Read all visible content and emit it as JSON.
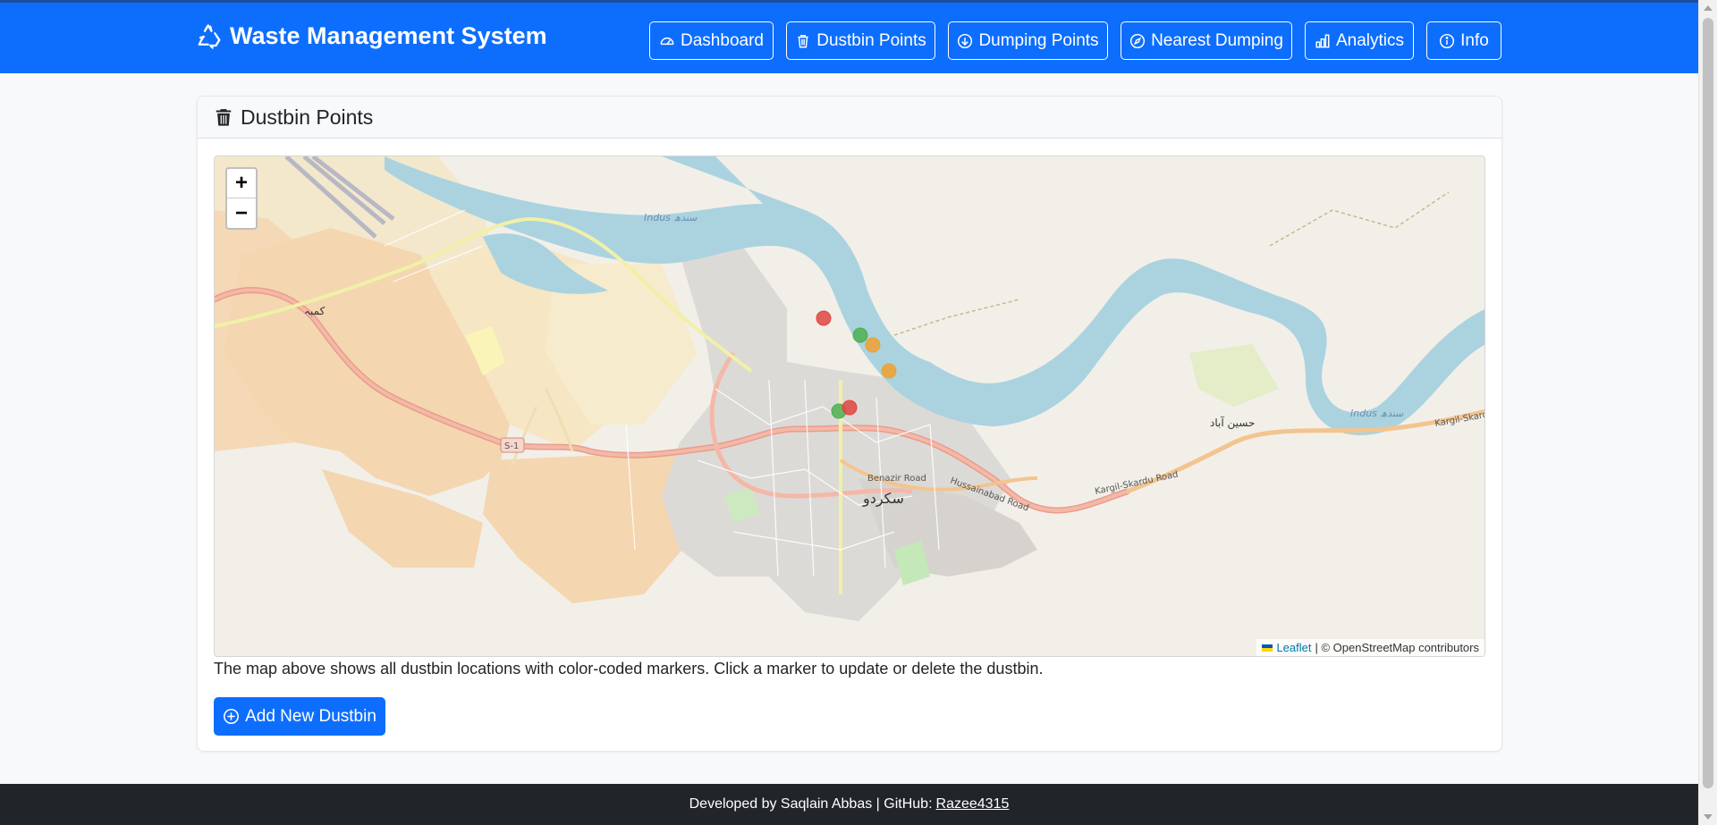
{
  "brand": {
    "title": "Waste Management System",
    "icon": "recycle-icon"
  },
  "nav": [
    {
      "label": "Dashboard",
      "icon": "speedometer-icon"
    },
    {
      "label": "Dustbin Points",
      "icon": "trash-icon"
    },
    {
      "label": "Dumping Points",
      "icon": "arrow-down-circle-icon"
    },
    {
      "label": "Nearest Dumping",
      "icon": "compass-icon"
    },
    {
      "label": "Analytics",
      "icon": "bar-chart-icon"
    },
    {
      "label": "Info",
      "icon": "info-circle-icon"
    }
  ],
  "card": {
    "title": "Dustbin Points",
    "icon": "trash-icon"
  },
  "map": {
    "zoom_in": "+",
    "zoom_out": "−",
    "attribution_leaflet": "Leaflet",
    "attribution_rest": "| © OpenStreetMap contributors",
    "labels": {
      "river_west": "Indus سندھ",
      "river_east": "Indus سندھ",
      "city": "سکردو",
      "village_west": "کمبہ",
      "village_east": "حسین آباد",
      "road_s1": "S-1",
      "road_kargil": "Kargil-Skardu Road",
      "road_kargil_east": "Kargil-Skardu R",
      "road_benazir": "Benazir Road",
      "road_hussainabad": "Hussainabad Road"
    },
    "marker_colors": {
      "red": "#e0453f",
      "green": "#4caf50",
      "orange": "#f0a030"
    }
  },
  "description": "The map above shows all dustbin locations with color-coded markers. Click a marker to update or delete the dustbin.",
  "add_button": {
    "label": "Add New Dustbin",
    "icon": "plus-circle-icon"
  },
  "footer": {
    "text": "Developed by Saqlain Abbas | GitHub:",
    "link": "Razee4315"
  }
}
